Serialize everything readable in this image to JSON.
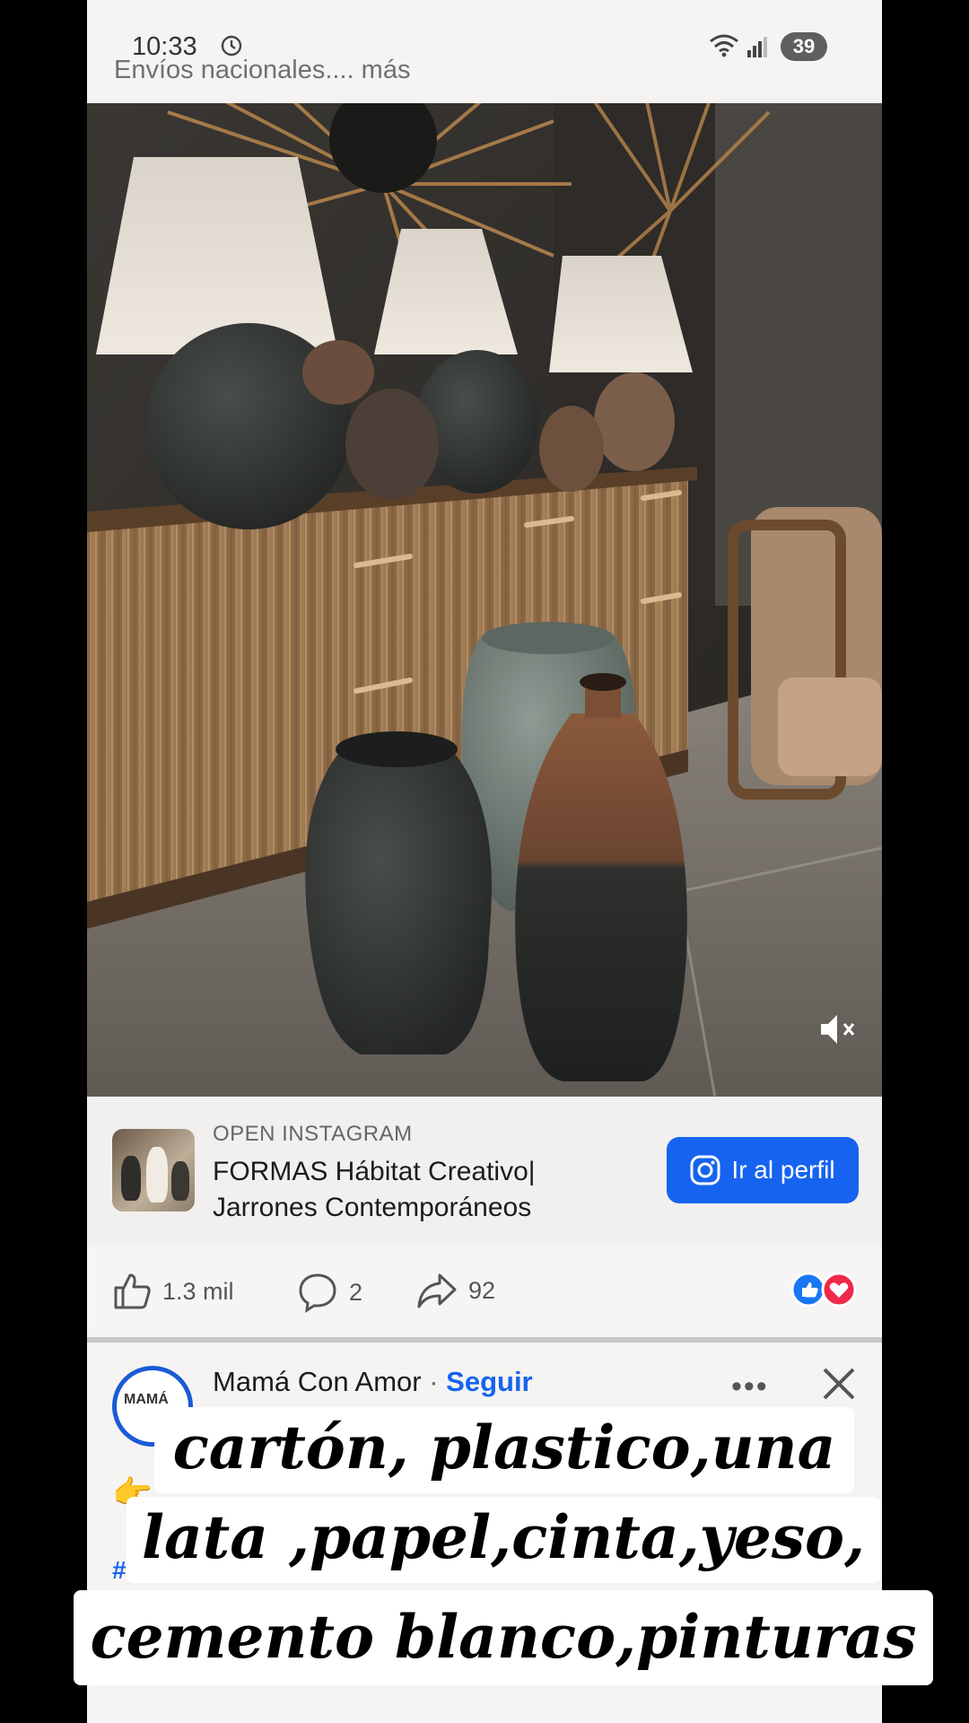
{
  "status_bar": {
    "time": "10:33",
    "battery": "39"
  },
  "previous_post": {
    "cutoff_text": "Envíos nacionales.... más"
  },
  "ad": {
    "kicker": "OPEN INSTAGRAM",
    "title": "FORMAS Hábitat Creativo| Jarrones Contemporáneos",
    "button_label": "Ir al perfil"
  },
  "reactions": {
    "likes": "1.3 mil",
    "comments": "2",
    "shares": "92"
  },
  "next_post": {
    "author": "Mamá Con Amor",
    "separator": "·",
    "follow_label": "Seguir",
    "avatar_text": "MAMÁ",
    "hashtag_prefix": "#"
  },
  "caption_overlay": {
    "line1": "cartón, plastico,una",
    "line2": "lata ,papel,cinta,yeso,",
    "line3": "cemento blanco,pinturas"
  },
  "colors": {
    "accent_blue": "#1663f0",
    "like_blue": "#1877f2",
    "love_red": "#f0284a"
  }
}
